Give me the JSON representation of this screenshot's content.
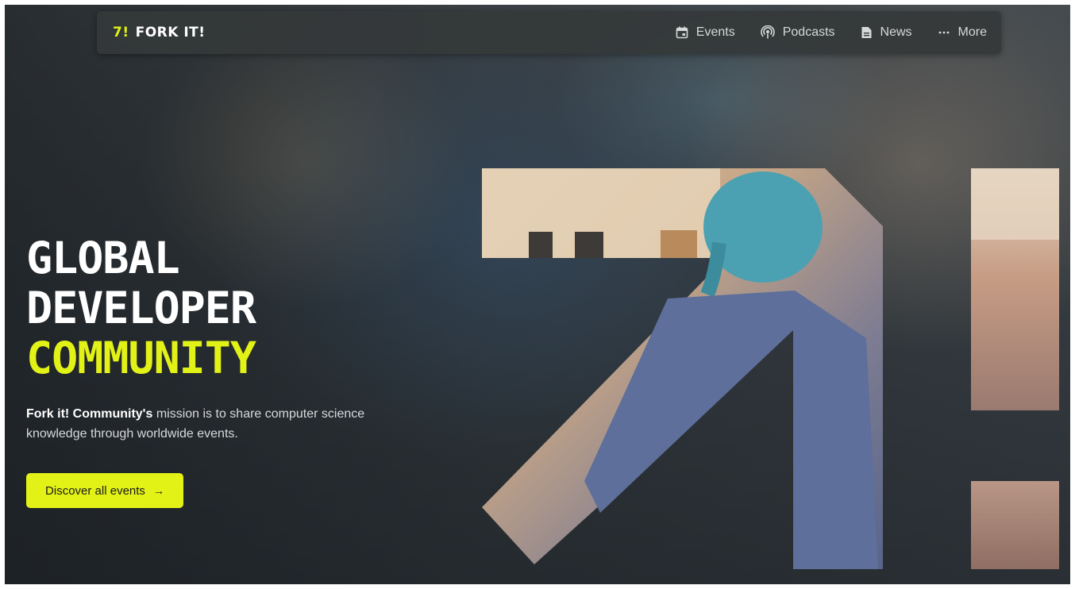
{
  "nav": {
    "brand_mark": "7!",
    "brand_name": "FORK IT!",
    "links": [
      {
        "label": "Events",
        "icon": "calendar-icon"
      },
      {
        "label": "Podcasts",
        "icon": "podcast-icon"
      },
      {
        "label": "News",
        "icon": "news-icon"
      },
      {
        "label": "More",
        "icon": "ellipsis-icon"
      }
    ]
  },
  "hero": {
    "line1": "GLOBAL",
    "line2": "DEVELOPER",
    "line3": "COMMUNITY",
    "mission_strong": "Fork it! Community's",
    "mission_text": " mission is to share computer science knowledge through worldwide events.",
    "cta_label": "Discover all events",
    "cta_arrow": "→"
  },
  "theme": {
    "accent": "#e2f216",
    "nav_bg": "#34383a",
    "text_light": "#ffffff"
  }
}
